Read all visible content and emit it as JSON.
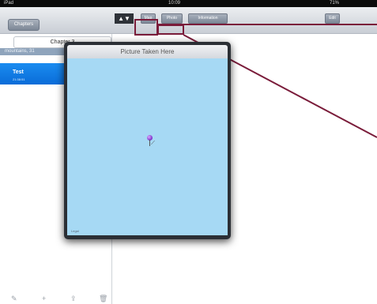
{
  "status": {
    "carrier": "iPad",
    "time": "10:09",
    "battery": "71%"
  },
  "left": {
    "back_label": "Chapters",
    "chapter_title": "Chapter 3",
    "section_label": "mountains, 31",
    "selected_item": {
      "title": "Test",
      "subtitle": "21:38:51"
    },
    "icons": {
      "compose": "✎",
      "add": "+",
      "share": "⇪",
      "trash": "🗑"
    }
  },
  "toolbar": {
    "arrows": "▲▼",
    "map_button": "Map",
    "photo_button": "Photo",
    "info_button": "Information",
    "edit_button": "Edit"
  },
  "popover": {
    "title": "Picture Taken Here",
    "legal": "Legal"
  },
  "colors": {
    "callout": "#7a1c3a",
    "map": "#a6d9f4",
    "selection": "#1a8cf0"
  }
}
